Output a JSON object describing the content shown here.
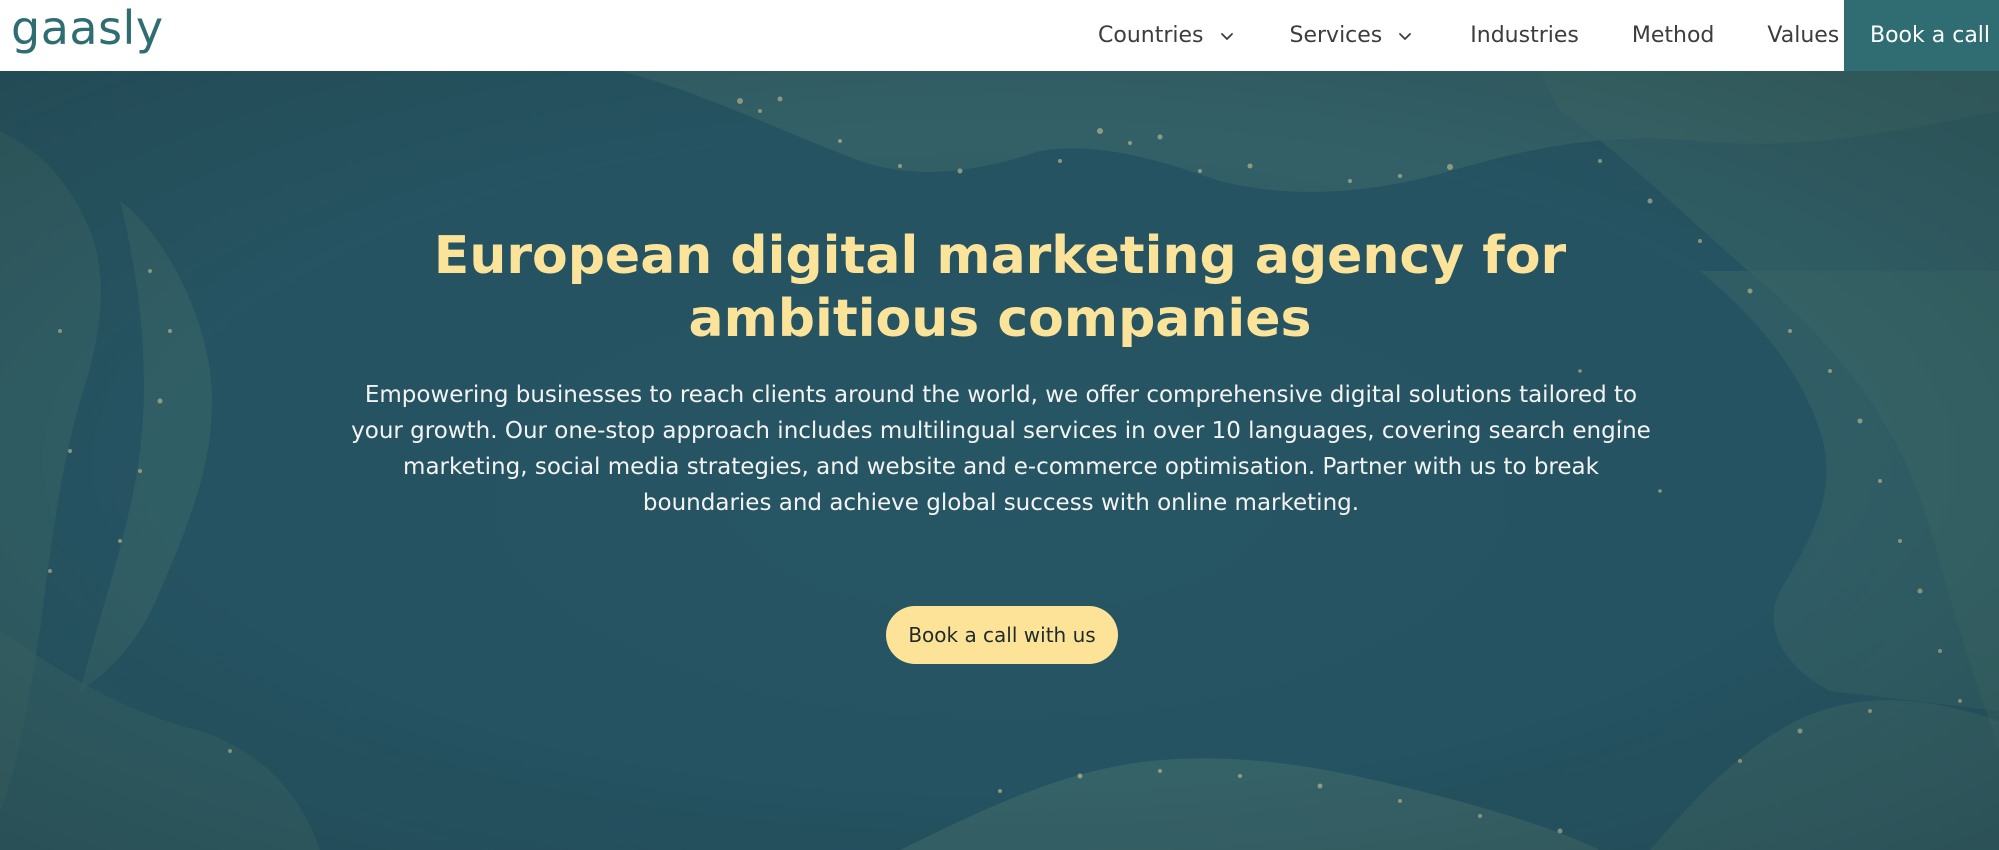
{
  "header": {
    "logo_text": "gaasly",
    "nav": [
      {
        "label": "Countries",
        "has_dropdown": true
      },
      {
        "label": "Services",
        "has_dropdown": true
      },
      {
        "label": "Industries",
        "has_dropdown": false
      },
      {
        "label": "Method",
        "has_dropdown": false
      },
      {
        "label": "Values",
        "has_dropdown": false
      }
    ],
    "cta_label": "Book a call"
  },
  "hero": {
    "title": "European digital marketing agency for ambitious companies",
    "description": "Empowering businesses to reach clients around the world, we offer comprehensive digital solutions tailored to your growth. Our one-stop approach includes multilingual services in over 10 languages, covering search engine marketing, social media strategies, and website and e-commerce optimisation. Partner with us to break boundaries and achieve global success with online marketing.",
    "cta_label": "Book a call with us",
    "background_image": "satellite night view of coastline with city lights"
  },
  "colors": {
    "brand_teal": "#2f6d72",
    "title_yellow": "#fbe49a",
    "cta_yellow": "#fde397",
    "hero_bg": "#295665",
    "nav_text": "#3d3d3d"
  },
  "icons": {
    "dropdown": "chevron-down-icon"
  }
}
